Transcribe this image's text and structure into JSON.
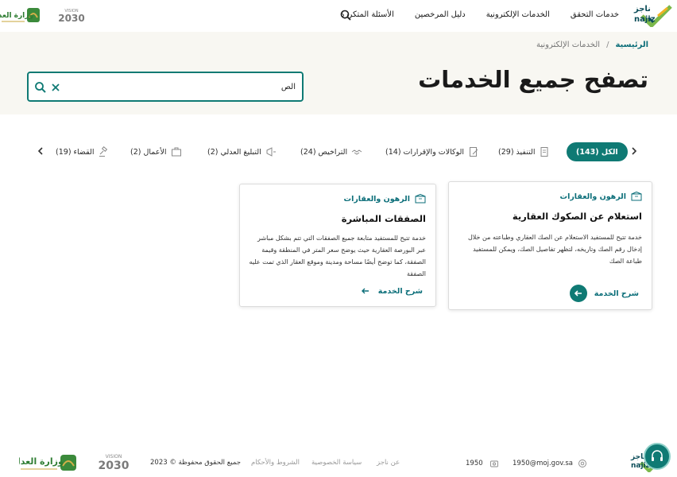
{
  "brand": {
    "name_ar": "ناجز",
    "name_en": "najiz"
  },
  "nav": {
    "items": [
      {
        "label": "خدمات التحقق"
      },
      {
        "label": "الخدمات الإلكترونية"
      },
      {
        "label": "دليل المرخصين"
      },
      {
        "label": "الأسئلة المتكررة"
      }
    ]
  },
  "moj_logo": {
    "text": "وزارة العدل",
    "sub": "MINISTRY OF JUSTICE"
  },
  "vision": {
    "text": "VISION 2030",
    "year": "2030",
    "sub": "رؤيـة"
  },
  "breadcrumb": {
    "home": "الرئيسية",
    "separator": "/",
    "current": "الخدمات الإلكترونية"
  },
  "page_title": "تصفح جميع الخدمات",
  "search": {
    "value": "الص",
    "placeholder": ""
  },
  "tabs": [
    {
      "label": "الكل (143)",
      "active": true,
      "icon": "none"
    },
    {
      "label": "التنفيذ (29)",
      "icon": "document-icon"
    },
    {
      "label": "الوكالات والإقرارات (14)",
      "icon": "file-signature-icon"
    },
    {
      "label": "التراخيص (24)",
      "icon": "handshake-icon"
    },
    {
      "label": "التبليغ العدلي (2)",
      "icon": "megaphone-icon"
    },
    {
      "label": "الأعمال (2)",
      "icon": "briefcase-icon"
    },
    {
      "label": "القضاء (19)",
      "icon": "gavel-icon"
    }
  ],
  "cards": [
    {
      "category": "الرهون والعقارات",
      "title": "استعلام عن الصكوك العقارية",
      "description": "خدمة تتيح للمستفيد الاستعلام عن الصك العقاري وطباعته من خلال إدخال رقم الصك وتاريخه، لتظهر تفاصيل الصك، ويمكن للمستفيد طباعة الصك",
      "link_label": "شرح الخدمة"
    },
    {
      "category": "الرهون والعقارات",
      "title": "الصفقات المباشرة",
      "description": "خدمة تتيح للمستفيد متابعة جميع الصفقات التي تتم بشكل مباشر عبر البورصة العقارية حيث يوضح سعر المتر في المنطقة وقيمة الصفقة، كما توضح أيضًا مساحة ومدينة وموقع العقار الذي تمت عليه الصفقة",
      "link_label": "شرح الخدمة"
    }
  ],
  "footer": {
    "email": "1950@moj.gov.sa",
    "phone": "1950",
    "links": [
      {
        "label": "عن ناجز"
      },
      {
        "label": "سياسة الخصوصية"
      },
      {
        "label": "الشروط والأحكام"
      }
    ],
    "copyright": "جميع الحقوق محفوظة © 2023"
  },
  "colors": {
    "primary": "#0f7a74",
    "accent_green": "#7bb84a",
    "hero_bg": "#f8f7f2",
    "dark": "#0b4d59"
  }
}
